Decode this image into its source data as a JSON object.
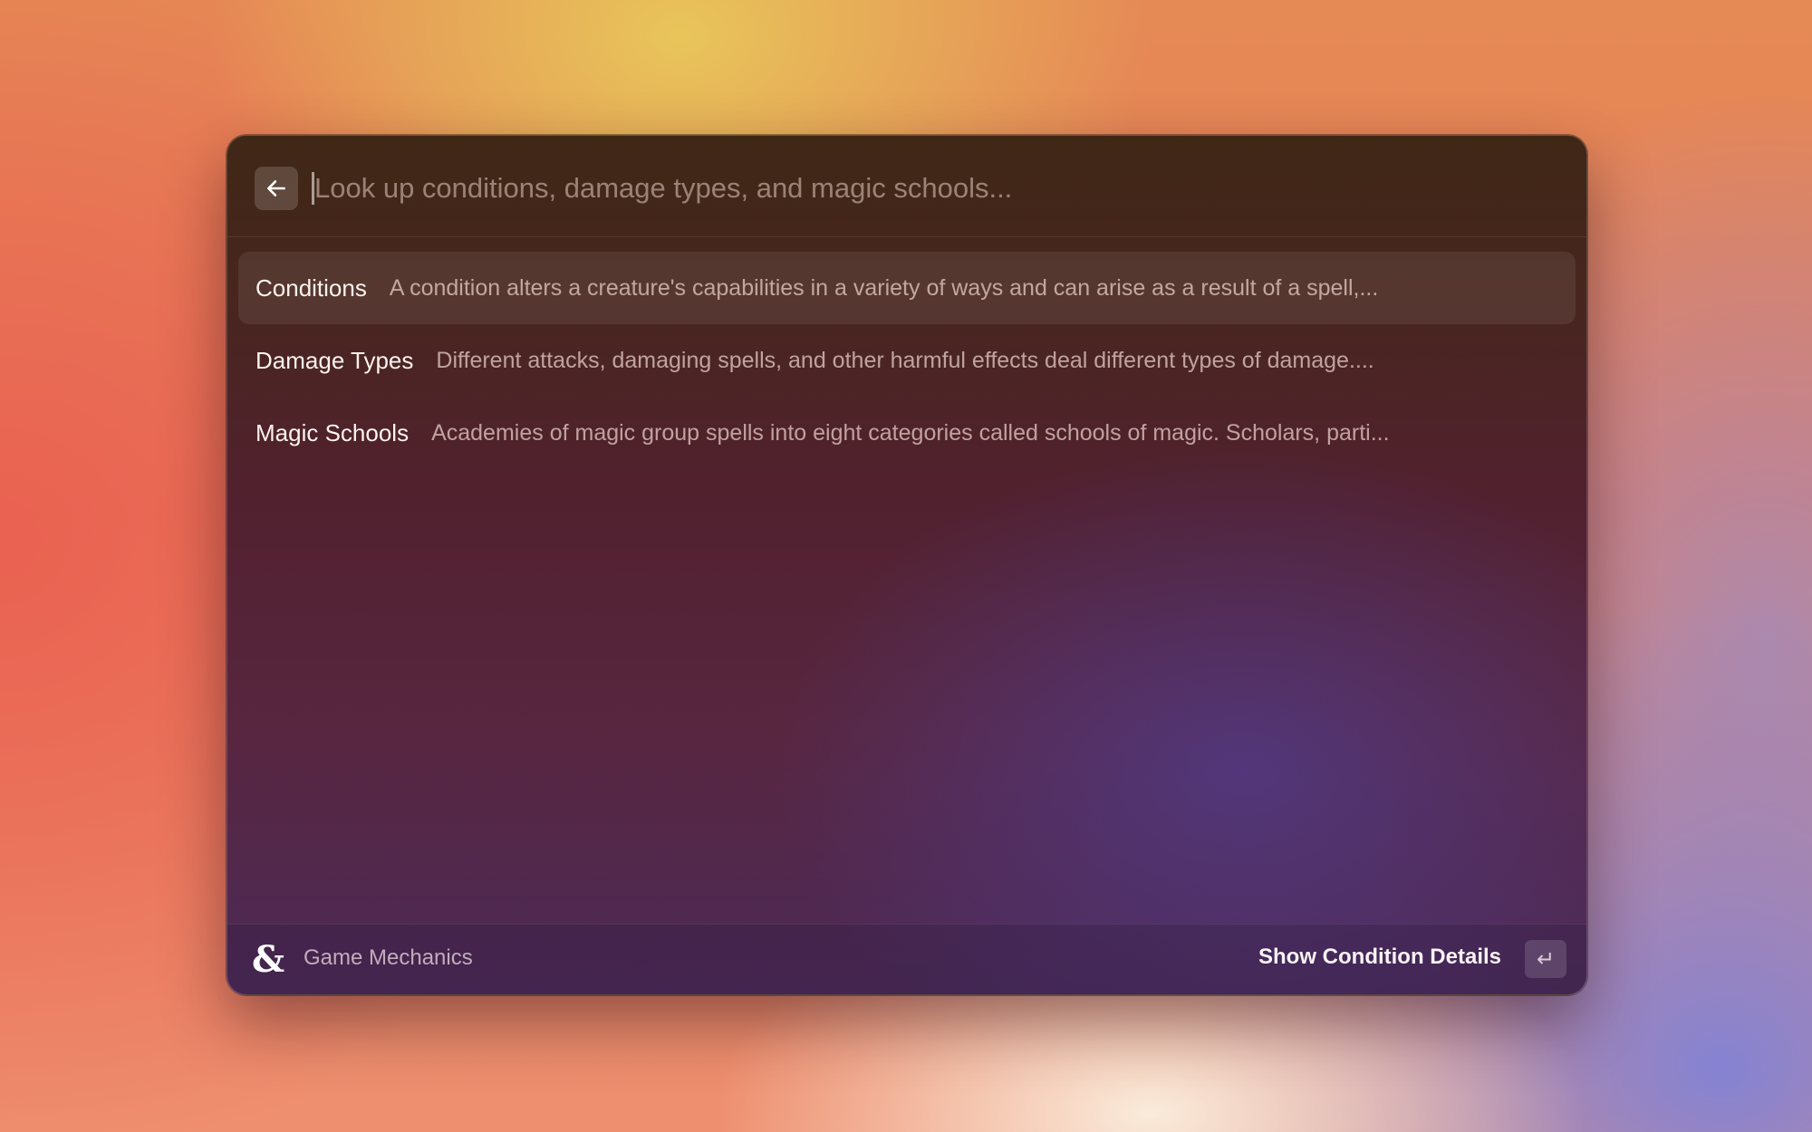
{
  "search": {
    "placeholder": "Look up conditions, damage types, and magic schools...",
    "value": ""
  },
  "results": [
    {
      "title": "Conditions",
      "description": "A condition alters a creature's capabilities in a variety of ways and can arise as a result of a spell,...",
      "selected": true
    },
    {
      "title": "Damage Types",
      "description": "Different attacks, damaging spells, and other harmful effects deal different types of damage....",
      "selected": false
    },
    {
      "title": "Magic Schools",
      "description": "Academies of magic group spells into eight categories called schools of magic. Scholars, parti...",
      "selected": false
    }
  ],
  "footer": {
    "logo_icon": "dnd-ampersand-icon",
    "logo_glyph": "&",
    "extension_name": "Game Mechanics",
    "primary_action": "Show Condition Details",
    "enter_key_icon": "return-key-icon",
    "enter_glyph": "↵"
  },
  "colors": {
    "window_top": "#3f2716",
    "window_bottom": "#4c2a58",
    "text_primary": "#fbf2ee"
  }
}
